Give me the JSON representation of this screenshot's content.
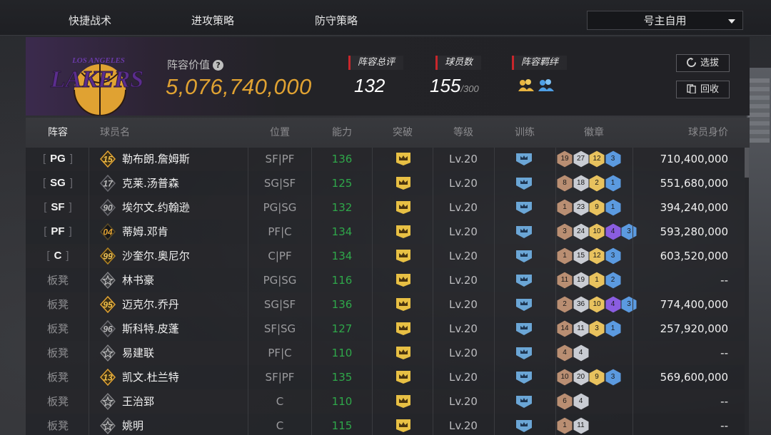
{
  "topnav": {
    "tabs": [
      "快捷战术",
      "进攻策略",
      "防守策略"
    ],
    "dropdown_value": "号主自用"
  },
  "team": {
    "logo_text": "LOS ANGELES LAKERS",
    "value_label": "阵容价值",
    "value": "5,076,740,000",
    "stats": [
      {
        "label": "阵容总评",
        "value": "132",
        "sub": ""
      },
      {
        "label": "球员数",
        "value": "155",
        "sub": "/300"
      },
      {
        "label": "阵容羁绊",
        "value": "",
        "sub": ""
      }
    ],
    "buttons": {
      "select": "选拔",
      "recycle": "回收"
    }
  },
  "colors": {
    "accent_gold": "#e0a232",
    "ability_green": "#2fa84a",
    "stat_red": "#c8262b",
    "lakers_purple": "#5b2d8e",
    "lakers_gold": "#f0b23a",
    "badge_bronze": "#b98e72",
    "badge_silver": "#c9ccd3",
    "badge_gold": "#e8c25e",
    "badge_purple": "#8a5de0",
    "badge_blue": "#5b9ae0"
  },
  "table": {
    "headers": [
      "阵容",
      "球员名",
      "位置",
      "能力",
      "突破",
      "等级",
      "训练",
      "徽章",
      "球员身价"
    ],
    "rows": [
      {
        "slot": "PG",
        "bench": false,
        "jersey": "15",
        "jersey_style": "gold",
        "name": "勒布朗.詹姆斯",
        "pos": "SF|PF",
        "ability": "136",
        "level": "Lv.20",
        "badges": [
          [
            "19",
            "bronze"
          ],
          [
            "27",
            "silver"
          ],
          [
            "12",
            "gold"
          ],
          [
            "3",
            "blue"
          ]
        ],
        "price": "710,400,000"
      },
      {
        "slot": "SG",
        "bench": false,
        "jersey": "17",
        "jersey_style": "dark",
        "name": "克莱.汤普森",
        "pos": "SG|SF",
        "ability": "125",
        "level": "Lv.20",
        "badges": [
          [
            "8",
            "bronze"
          ],
          [
            "18",
            "silver"
          ],
          [
            "2",
            "gold"
          ],
          [
            "1",
            "blue"
          ]
        ],
        "price": "551,680,000"
      },
      {
        "slot": "SF",
        "bench": false,
        "jersey": "90",
        "jersey_style": "dark",
        "name": "埃尔文.约翰逊",
        "pos": "PG|SG",
        "ability": "132",
        "level": "Lv.20",
        "badges": [
          [
            "1",
            "bronze"
          ],
          [
            "23",
            "silver"
          ],
          [
            "9",
            "gold"
          ],
          [
            "1",
            "blue"
          ]
        ],
        "price": "394,240,000"
      },
      {
        "slot": "PF",
        "bench": false,
        "jersey": "04",
        "jersey_style": "black-gold",
        "name": "蒂姆.邓肯",
        "pos": "PF|C",
        "ability": "134",
        "level": "Lv.20",
        "badges": [
          [
            "3",
            "bronze"
          ],
          [
            "24",
            "silver"
          ],
          [
            "10",
            "gold"
          ],
          [
            "4",
            "purple"
          ],
          [
            "3",
            "blue"
          ]
        ],
        "price": "593,280,000"
      },
      {
        "slot": "C",
        "bench": false,
        "jersey": "99",
        "jersey_style": "gold-flat",
        "name": "沙奎尔.奥尼尔",
        "pos": "C|PF",
        "ability": "134",
        "level": "Lv.20",
        "badges": [
          [
            "1",
            "bronze"
          ],
          [
            "15",
            "silver"
          ],
          [
            "12",
            "gold"
          ],
          [
            "3",
            "blue"
          ]
        ],
        "price": "603,520,000"
      },
      {
        "slot": "板凳",
        "bench": true,
        "jersey": "",
        "jersey_style": "star",
        "name": "林书豪",
        "pos": "PG|SG",
        "ability": "116",
        "level": "Lv.20",
        "badges": [
          [
            "11",
            "bronze"
          ],
          [
            "19",
            "silver"
          ],
          [
            "1",
            "gold"
          ],
          [
            "2",
            "blue"
          ]
        ],
        "price": "--"
      },
      {
        "slot": "板凳",
        "bench": true,
        "jersey": "95",
        "jersey_style": "gold",
        "name": "迈克尔.乔丹",
        "pos": "SG|SF",
        "ability": "136",
        "level": "Lv.20",
        "badges": [
          [
            "2",
            "bronze"
          ],
          [
            "36",
            "silver"
          ],
          [
            "10",
            "gold"
          ],
          [
            "4",
            "purple"
          ],
          [
            "3",
            "blue"
          ]
        ],
        "price": "774,400,000"
      },
      {
        "slot": "板凳",
        "bench": true,
        "jersey": "96",
        "jersey_style": "dark",
        "name": "斯科特.皮蓬",
        "pos": "SF|SG",
        "ability": "127",
        "level": "Lv.20",
        "badges": [
          [
            "14",
            "bronze"
          ],
          [
            "11",
            "silver"
          ],
          [
            "3",
            "gold"
          ],
          [
            "1",
            "blue"
          ]
        ],
        "price": "257,920,000"
      },
      {
        "slot": "板凳",
        "bench": true,
        "jersey": "",
        "jersey_style": "star",
        "name": "易建联",
        "pos": "PF|C",
        "ability": "110",
        "level": "Lv.20",
        "badges": [
          [
            "4",
            "bronze"
          ],
          [
            "4",
            "silver"
          ]
        ],
        "price": "--"
      },
      {
        "slot": "板凳",
        "bench": true,
        "jersey": "13",
        "jersey_style": "gold",
        "name": "凯文.杜兰特",
        "pos": "SF|PF",
        "ability": "135",
        "level": "Lv.20",
        "badges": [
          [
            "10",
            "bronze"
          ],
          [
            "20",
            "silver"
          ],
          [
            "9",
            "gold"
          ],
          [
            "3",
            "blue"
          ]
        ],
        "price": "569,600,000"
      },
      {
        "slot": "板凳",
        "bench": true,
        "jersey": "",
        "jersey_style": "star",
        "name": "王治郅",
        "pos": "C",
        "ability": "110",
        "level": "Lv.20",
        "badges": [
          [
            "6",
            "bronze"
          ],
          [
            "4",
            "silver"
          ]
        ],
        "price": "--"
      },
      {
        "slot": "板凳",
        "bench": true,
        "jersey": "",
        "jersey_style": "star",
        "name": "姚明",
        "pos": "C",
        "ability": "115",
        "level": "Lv.20",
        "badges": [
          [
            "1",
            "bronze"
          ],
          [
            "11",
            "silver"
          ]
        ],
        "price": "--"
      }
    ]
  }
}
